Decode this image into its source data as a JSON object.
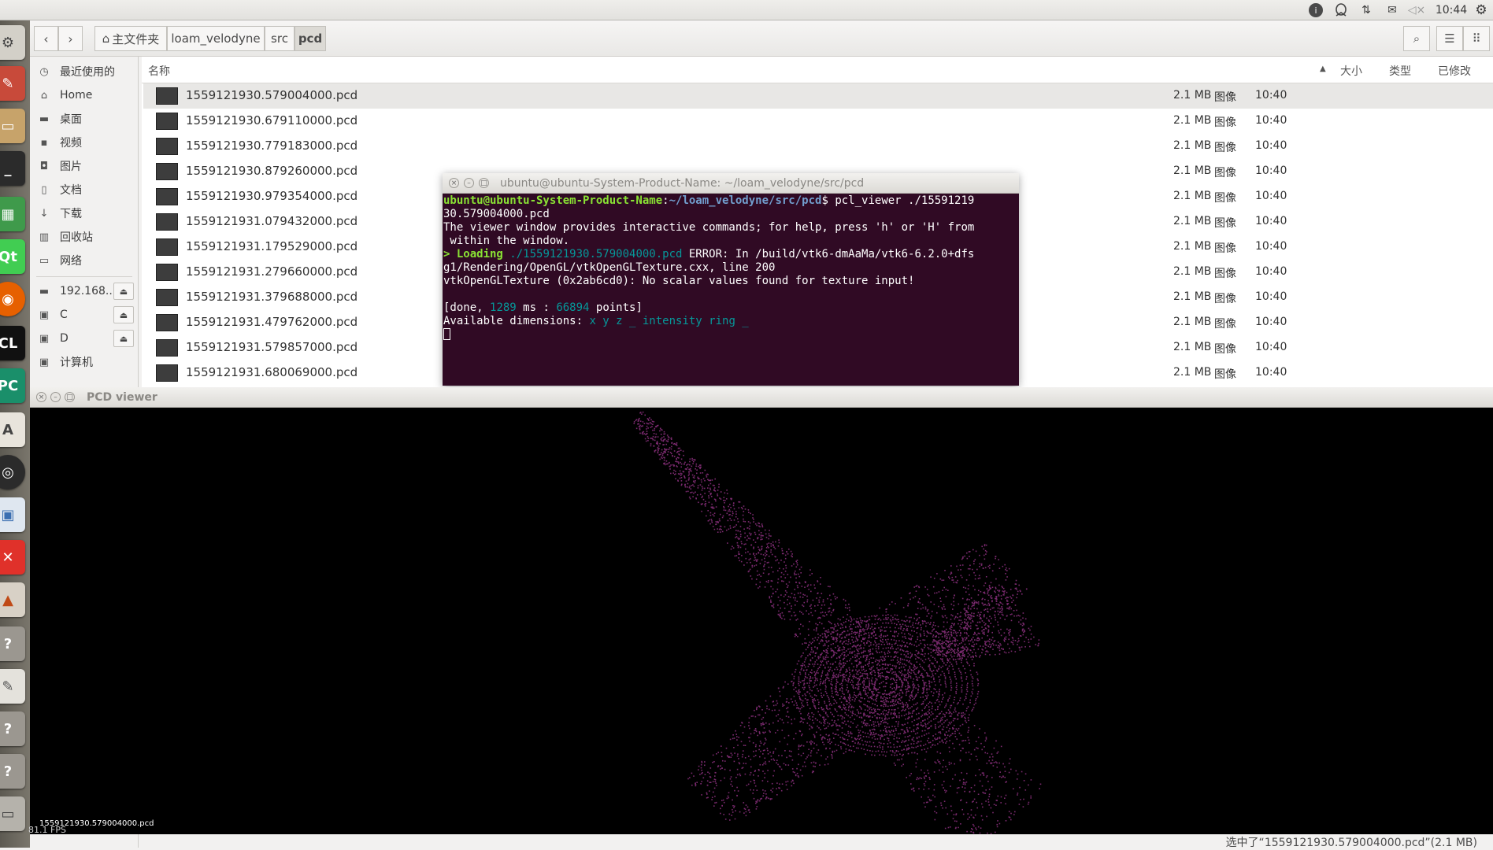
{
  "topbar": {
    "time": "10:44",
    "indicators": [
      "ubuntu-one-icon",
      "qq-icon",
      "network-transfer-icon",
      "mail-icon",
      "volume-muted-icon",
      "settings-gear-icon"
    ]
  },
  "launcher": {
    "apps": [
      "system-settings",
      "text-tool",
      "files",
      "terminal",
      "spreadsheet",
      "qt-creator",
      "firefox",
      "clion",
      "pycharm",
      "software-center",
      "camera",
      "image-viewer",
      "xmind",
      "matlab",
      "unknown-app",
      "text-editor",
      "unknown-app-2",
      "unknown-app-3",
      "drive"
    ]
  },
  "filemanager": {
    "breadcrumb": [
      "主文件夹",
      "loam_velodyne",
      "src",
      "pcd"
    ],
    "sidebar": [
      {
        "label": "最近使用的",
        "icon": "clock-icon"
      },
      {
        "label": "Home",
        "icon": "home-icon"
      },
      {
        "label": "桌面",
        "icon": "folder-icon"
      },
      {
        "label": "视频",
        "icon": "video-icon"
      },
      {
        "label": "图片",
        "icon": "camera-icon"
      },
      {
        "label": "文档",
        "icon": "document-icon"
      },
      {
        "label": "下载",
        "icon": "download-icon"
      },
      {
        "label": "回收站",
        "icon": "trash-icon"
      },
      {
        "label": "网络",
        "icon": "network-icon"
      },
      {
        "label": "192.168....",
        "icon": "network-drive-icon",
        "eject": true
      },
      {
        "label": "C",
        "icon": "drive-icon",
        "eject": true
      },
      {
        "label": "D",
        "icon": "drive-icon",
        "eject": true
      },
      {
        "label": "计算机",
        "icon": "computer-icon"
      }
    ],
    "columns": {
      "name": "名称",
      "size": "大小",
      "type": "类型",
      "modified": "已修改"
    },
    "files": [
      {
        "name": "1559121930.579004000.pcd",
        "size": "2.1 MB",
        "type": "图像",
        "modified": "10:40"
      },
      {
        "name": "1559121930.679110000.pcd",
        "size": "2.1 MB",
        "type": "图像",
        "modified": "10:40"
      },
      {
        "name": "1559121930.779183000.pcd",
        "size": "2.1 MB",
        "type": "图像",
        "modified": "10:40"
      },
      {
        "name": "1559121930.879260000.pcd",
        "size": "2.1 MB",
        "type": "图像",
        "modified": "10:40"
      },
      {
        "name": "1559121930.979354000.pcd",
        "size": "2.1 MB",
        "type": "图像",
        "modified": "10:40"
      },
      {
        "name": "1559121931.079432000.pcd",
        "size": "2.1 MB",
        "type": "图像",
        "modified": "10:40"
      },
      {
        "name": "1559121931.179529000.pcd",
        "size": "2.1 MB",
        "type": "图像",
        "modified": "10:40"
      },
      {
        "name": "1559121931.279660000.pcd",
        "size": "2.1 MB",
        "type": "图像",
        "modified": "10:40"
      },
      {
        "name": "1559121931.379688000.pcd",
        "size": "2.1 MB",
        "type": "图像",
        "modified": "10:40"
      },
      {
        "name": "1559121931.479762000.pcd",
        "size": "2.1 MB",
        "type": "图像",
        "modified": "10:40"
      },
      {
        "name": "1559121931.579857000.pcd",
        "size": "2.1 MB",
        "type": "图像",
        "modified": "10:40"
      },
      {
        "name": "1559121931.680069000.pcd",
        "size": "2.1 MB",
        "type": "图像",
        "modified": "10:40"
      }
    ],
    "status": "选中了“1559121930.579004000.pcd”(2.1 MB)"
  },
  "terminal": {
    "title": "ubuntu@ubuntu-System-Product-Name: ~/loam_velodyne/src/pcd",
    "prompt_user": "ubuntu@ubuntu-System-Product-Name",
    "prompt_path": "~/loam_velodyne/src/pcd",
    "command": "$ pcl_viewer ./15591219",
    "command_cont": "30.579004000.pcd",
    "line_help1": "The viewer window provides interactive commands; for help, press 'h' or 'H' from",
    "line_help2": " within the window.",
    "loading_prefix": "> Loading ",
    "loading_file": "./1559121930.579004000.pcd",
    "loading_error": " ERROR: In /build/vtk6-dmAaMa/vtk6-6.2.0+dfs",
    "error_cont": "g1/Rendering/OpenGL/vtkOpenGLTexture.cxx, line 200",
    "error_line2": "vtkOpenGLTexture (0x2ab6cd0): No scalar values found for texture input!",
    "done_prefix": "[done, ",
    "done_ms": "1289",
    "done_mid": " ms : ",
    "done_points": "66894",
    "done_suffix": " points]",
    "dims_prefix": "Available dimensions: ",
    "dims_values": "x y z _ intensity ring _"
  },
  "pcd_viewer": {
    "title": "PCD viewer",
    "filename": "1559121930.579004000.pcd",
    "fps": "81.1 FPS",
    "point_color": "#7a2a6e"
  }
}
